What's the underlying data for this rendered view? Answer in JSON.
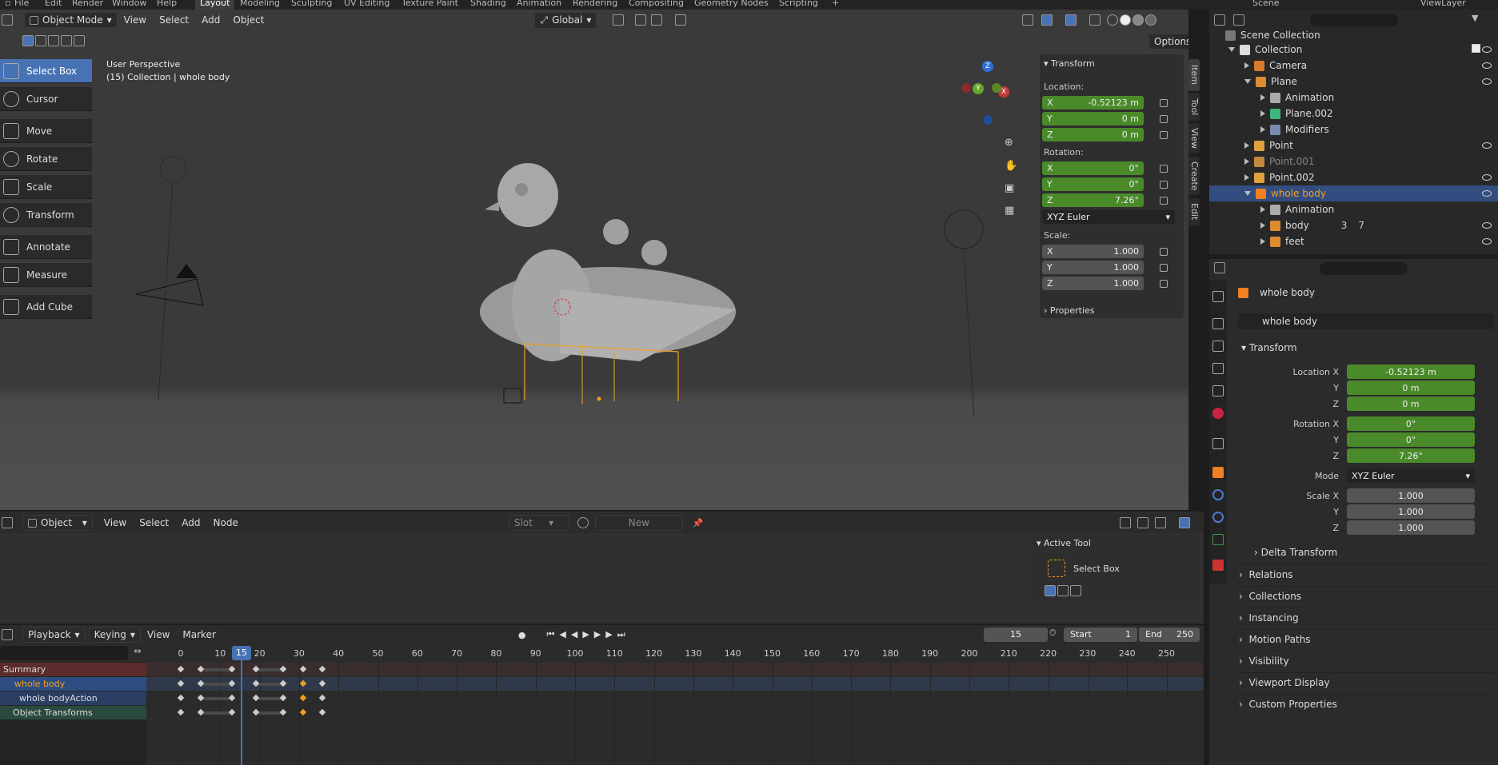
{
  "topbar": {
    "menus": [
      "File",
      "Edit",
      "Render",
      "Window",
      "Help"
    ],
    "workspaces": [
      "Layout",
      "Modeling",
      "Sculpting",
      "UV Editing",
      "Texture Paint",
      "Shading",
      "Animation",
      "Rendering",
      "Compositing",
      "Geometry Nodes",
      "Scripting"
    ],
    "active_workspace": "Layout",
    "scene": "Scene",
    "view_layer": "ViewLayer"
  },
  "viewport": {
    "mode": "Object Mode",
    "menus": [
      "View",
      "Select",
      "Add",
      "Object"
    ],
    "orientation": "Global",
    "options": "Options",
    "info_line1": "User Perspective",
    "info_line2": "(15) Collection | whole body",
    "tools": [
      "Select Box",
      "Cursor",
      "Move",
      "Rotate",
      "Scale",
      "Transform",
      "Annotate",
      "Measure",
      "Add Cube"
    ],
    "gizmo": {
      "x": "X",
      "y": "Y",
      "z": "Z"
    },
    "tabs": [
      "Item",
      "Tool",
      "View",
      "Create",
      "Edit"
    ]
  },
  "npanel": {
    "transform_title": "Transform",
    "location_label": "Location:",
    "loc": [
      "-0.52123 m",
      "0 m",
      "0 m"
    ],
    "rotation_label": "Rotation:",
    "rot": [
      "0°",
      "0°",
      "7.26°"
    ],
    "rot_mode": "XYZ Euler",
    "scale_label": "Scale:",
    "scale": [
      "1.000",
      "1.000",
      "1.000"
    ],
    "axes": [
      "X",
      "Y",
      "Z"
    ],
    "properties": "Properties"
  },
  "outliner": {
    "root": "Scene Collection",
    "rows": [
      {
        "label": "Collection",
        "indent": 1
      },
      {
        "label": "Camera",
        "indent": 2
      },
      {
        "label": "Plane",
        "indent": 2
      },
      {
        "label": "Animation",
        "indent": 3
      },
      {
        "label": "Plane.002",
        "indent": 3
      },
      {
        "label": "Modifiers",
        "indent": 3
      },
      {
        "label": "Point",
        "indent": 2
      },
      {
        "label": "Point.001",
        "indent": 2
      },
      {
        "label": "Point.002",
        "indent": 2
      },
      {
        "label": "whole body",
        "indent": 2
      },
      {
        "label": "Animation",
        "indent": 3
      },
      {
        "label": "body",
        "indent": 3
      },
      {
        "label": "feet",
        "indent": 3
      }
    ],
    "badges": {
      "body_a": "3",
      "body_b": "7"
    }
  },
  "properties": {
    "object_name": "whole body",
    "object_field": "whole body",
    "transform": "Transform",
    "location_x_label": "Location X",
    "rotation_x_label": "Rotation X",
    "scale_x_label": "Scale X",
    "mode_label": "Mode",
    "y_label": "Y",
    "z_label": "Z",
    "loc": [
      "-0.52123 m",
      "0 m",
      "0 m"
    ],
    "rot": [
      "0°",
      "0°",
      "7.26°"
    ],
    "mode": "XYZ Euler",
    "scale": [
      "1.000",
      "1.000",
      "1.000"
    ],
    "delta": "Delta Transform",
    "sections": [
      "Relations",
      "Collections",
      "Instancing",
      "Motion Paths",
      "Visibility",
      "Viewport Display",
      "Custom Properties"
    ]
  },
  "shader_editor": {
    "mode": "Object",
    "menus": [
      "View",
      "Select",
      "Add",
      "Node"
    ],
    "slot": "Slot",
    "new": "New",
    "active_tool_title": "Active Tool",
    "active_tool_name": "Select Box"
  },
  "timeline": {
    "menus": [
      "Playback",
      "Keying",
      "View",
      "Marker"
    ],
    "current_frame": "15",
    "start_label": "Start",
    "start": "1",
    "end_label": "End",
    "end": "250",
    "ticks": [
      "0",
      "10",
      "20",
      "30",
      "40",
      "50",
      "60",
      "70",
      "80",
      "90",
      "100",
      "110",
      "120",
      "130",
      "140",
      "150",
      "160",
      "170",
      "180",
      "190",
      "200",
      "210",
      "220",
      "230",
      "240",
      "250"
    ],
    "playhead": "15",
    "channels": [
      "Summary",
      "whole body",
      "whole bodyAction",
      "Object Transforms"
    ]
  },
  "colors": {
    "accent": "#4772b3",
    "field_green": "#4a8a2a",
    "selected_orange": "#f0a020"
  }
}
